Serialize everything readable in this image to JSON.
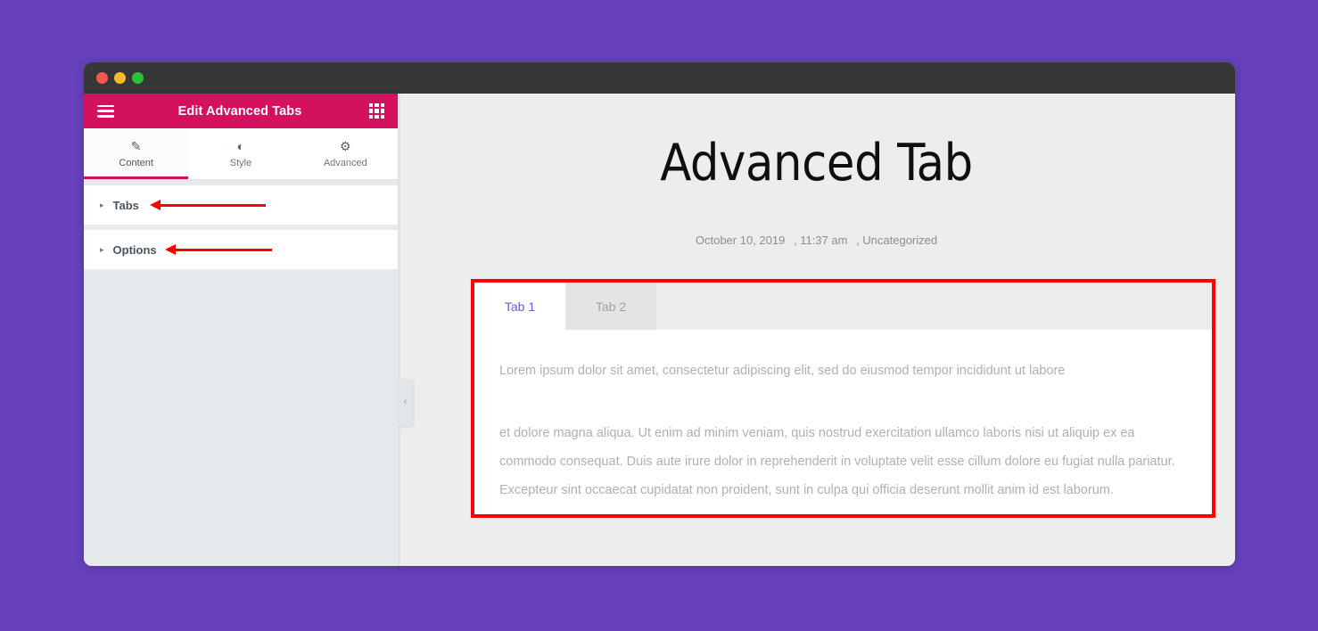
{
  "window": {
    "traffic_lights": [
      "close",
      "minimize",
      "maximize"
    ],
    "colors": {
      "desktop_background": "#6640bb",
      "titlebar": "#37373a",
      "panel_accent": "#d3115f",
      "annotation_red": "#fe0000",
      "active_tab_text": "#6160d8"
    }
  },
  "panel": {
    "menu_icon": "hamburger-icon",
    "title": "Edit Advanced Tabs",
    "widgets_icon": "grid-icon",
    "tabs": [
      {
        "label": "Content",
        "icon": "pencil-icon",
        "glyph": "✎",
        "active": true
      },
      {
        "label": "Style",
        "icon": "contrast-icon",
        "glyph": "◐",
        "active": false
      },
      {
        "label": "Advanced",
        "icon": "gear-icon",
        "glyph": "⚙",
        "active": false
      }
    ],
    "sections": [
      {
        "title": "Tabs",
        "expanded": false,
        "arrow": "▸",
        "annotated": true
      },
      {
        "title": "Options",
        "expanded": false,
        "arrow": "▸",
        "annotated": true
      }
    ],
    "collapse_handle": {
      "icon": "chevron-left-icon",
      "glyph": "‹"
    }
  },
  "canvas": {
    "post_title": "Advanced Tab",
    "post_meta": {
      "date": "October 10, 2019",
      "time": ", 11:37 am",
      "category": ", Uncategorized"
    },
    "tabs_widget": {
      "tabs": [
        {
          "label": "Tab 1",
          "active": true
        },
        {
          "label": "Tab 2",
          "active": false
        }
      ],
      "paragraphs": [
        "Lorem ipsum dolor sit amet, consectetur adipiscing elit, sed do eiusmod tempor incididunt ut labore",
        "et dolore magna aliqua. Ut enim ad minim veniam, quis nostrud exercitation ullamco laboris nisi ut aliquip ex ea commodo consequat. Duis aute irure dolor in reprehenderit in voluptate velit esse cillum dolore eu fugiat nulla pariatur. Excepteur sint occaecat cupidatat non proident, sunt in culpa qui officia deserunt mollit anim id est laborum."
      ]
    }
  }
}
